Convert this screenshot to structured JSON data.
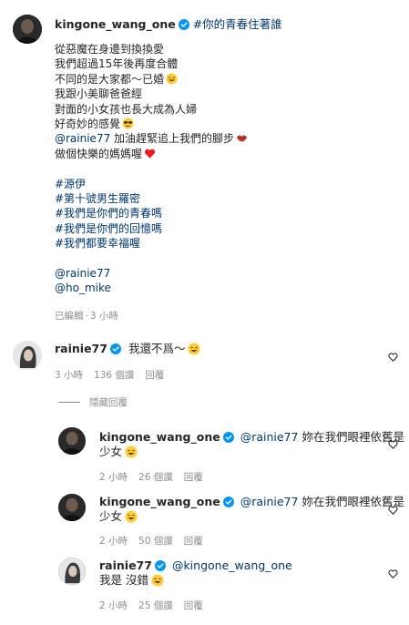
{
  "post": {
    "username": "kingone_wang_one",
    "hashtag": "#你的青春住著誰",
    "caption_lines": [
      "從惡魔在身邊到換換愛",
      "我們超過15年後再度合體",
      "不同的是大家都～已婚",
      "我跟小美聊爸爸經",
      "對面的小女孩也長大成為人婦",
      "好奇妙的感覺",
      "加油趕緊追上我們的腳步",
      "做個快樂的媽媽喔",
      "",
      "#源伊",
      "#第十號男生羅密",
      "#我們是你們的青春嗎",
      "#我們是你們的回憶嗎",
      "#我們都要幸福喔",
      "",
      "@rainie77",
      "@ho_mike"
    ],
    "caption_mention": "@rainie77",
    "edited": "已編輯",
    "dot": "·",
    "time": "3 小時"
  },
  "comments": [
    {
      "username": "rainie77",
      "mention": "",
      "text": "我還不爲～",
      "text2": "",
      "time": "3 小時",
      "likes": "136 個讚",
      "reply": "回覆"
    },
    {
      "username": "kingone_wang_one",
      "mention": "@rainie77",
      "text": "妳在我們眼裡依舊是",
      "text2": "少女",
      "time": "2 小時",
      "likes": "26 個讚",
      "reply": "回覆"
    },
    {
      "username": "kingone_wang_one",
      "mention": "@rainie77",
      "text": "妳在我們眼裡依舊是",
      "text2": "少女",
      "time": "2 小時",
      "likes": "50 個讚",
      "reply": "回覆"
    },
    {
      "username": "rainie77",
      "mention": "@kingone_wang_one",
      "text": "",
      "text2": "我是 沒錯",
      "time": "2 小時",
      "likes": "25 個讚",
      "reply": "回覆"
    }
  ],
  "hide_replies": "隱藏回覆",
  "colors": {
    "text": "#262626",
    "link": "#00376b",
    "meta": "#8e8e8e",
    "verified": "#0095f6",
    "heart_red": "#ed1c24"
  },
  "icons": {
    "verified": "verified-badge-icon",
    "like": "heart-outline-icon",
    "laugh": "laughing-emoji-icon",
    "sunglasses": "sunglasses-emoji-icon",
    "lips": "lips-emoji-icon",
    "red_heart": "red-heart-emoji-icon"
  }
}
